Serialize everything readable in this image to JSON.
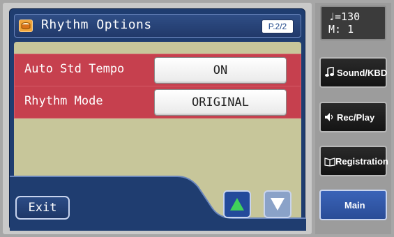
{
  "header": {
    "title": "Rhythm Options",
    "page": "P.2/2"
  },
  "settings": [
    {
      "label": "Auto Std Tempo",
      "value": "ON"
    },
    {
      "label": "Rhythm Mode",
      "value": "ORIGINAL"
    }
  ],
  "footer": {
    "exit_label": "Exit"
  },
  "tempo": {
    "line1": "♩=130",
    "line2": "M:   1"
  },
  "side_buttons": {
    "sound_kbd": "Sound/KBD",
    "rec_play": "Rec/Play",
    "registration": "Registration",
    "main": "Main"
  },
  "icons": [
    "drum-icon",
    "arrow-up-icon",
    "arrow-down-icon",
    "music-note-icon",
    "speaker-icon",
    "book-icon"
  ],
  "colors": {
    "row": "#c6404e",
    "content": "#c7c69a",
    "screen": "#1f3d70",
    "accent": "#2a4d97"
  }
}
